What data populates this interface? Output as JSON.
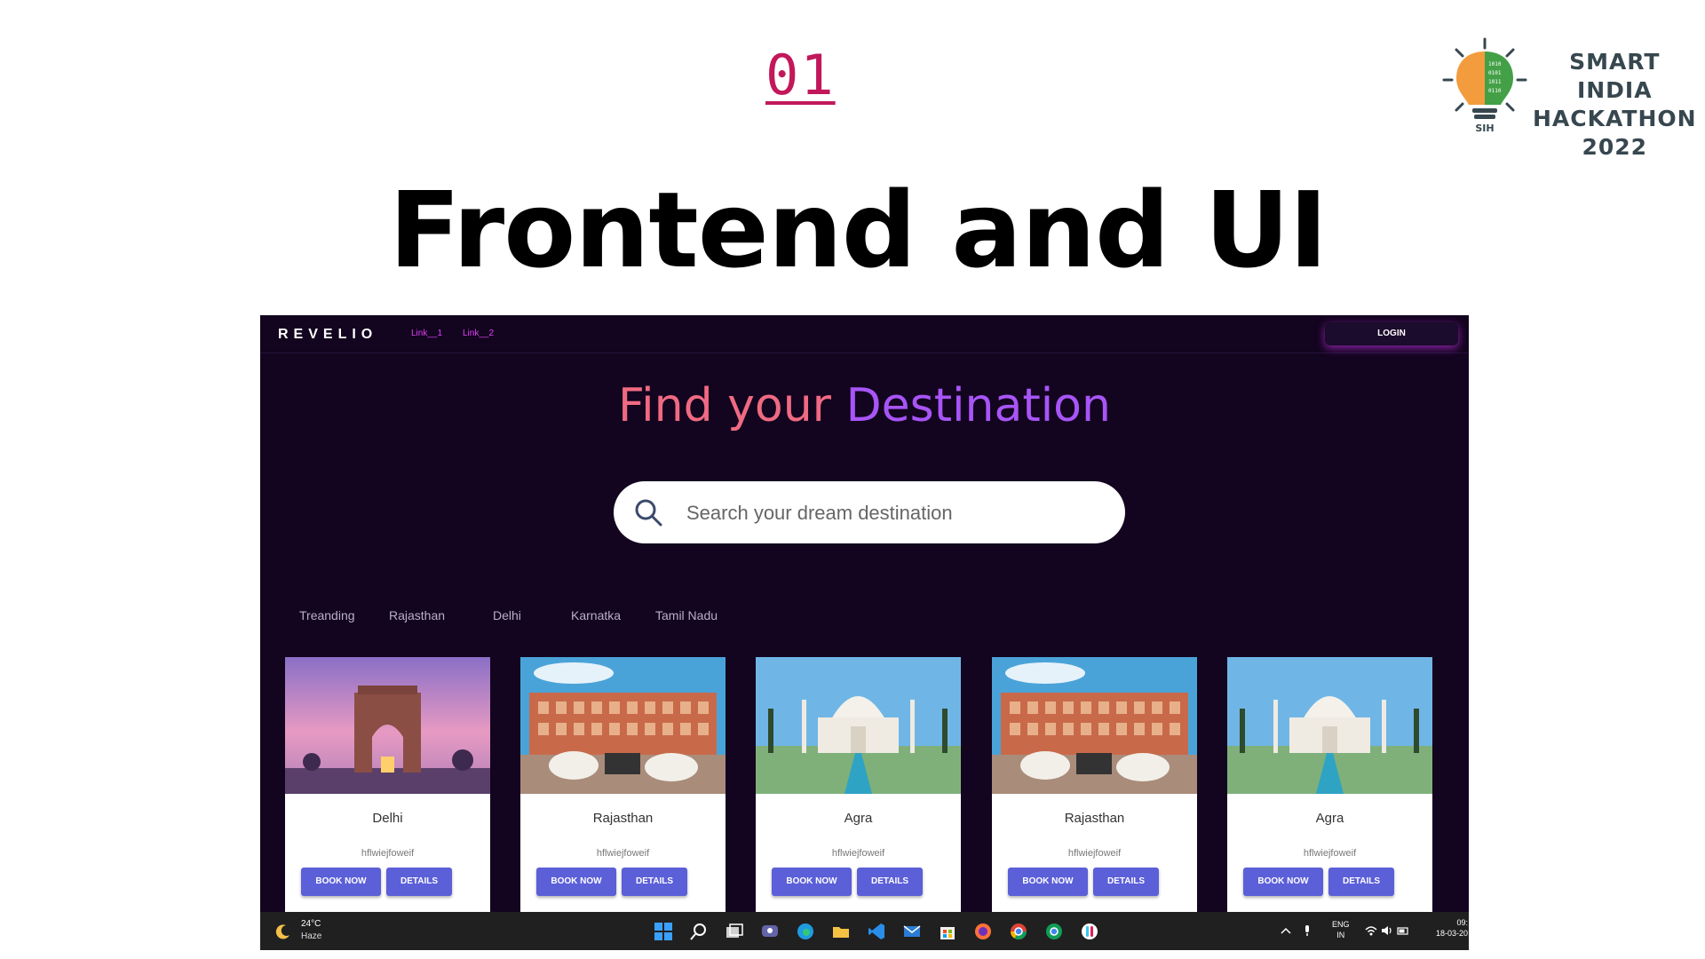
{
  "slide": {
    "number": "01",
    "title": "Frontend and UI",
    "logo_line1": "SMART INDIA",
    "logo_line2": "HACKATHON",
    "logo_line3": "2022",
    "logo_badge": "SIH"
  },
  "app": {
    "brand": "REVELIO",
    "nav_links": [
      "Link__1",
      "Link__2"
    ],
    "login_label": "LOGIN",
    "hero_part1": "Find your ",
    "hero_part2": "Destination",
    "search_placeholder": "Search your dream destination",
    "tabs": [
      "Treanding",
      "Rajasthan",
      "Delhi",
      "Karnatka",
      "Tamil Nadu"
    ],
    "cards": [
      {
        "title": "Delhi",
        "desc": "hflwiejfoweif",
        "book": "BOOK NOW",
        "details": "DETAILS",
        "image": "india-gate"
      },
      {
        "title": "Rajasthan",
        "desc": "hflwiejfoweif",
        "book": "BOOK NOW",
        "details": "DETAILS",
        "image": "hawa-mahal"
      },
      {
        "title": "Agra",
        "desc": "hflwiejfoweif",
        "book": "BOOK NOW",
        "details": "DETAILS",
        "image": "taj-mahal"
      },
      {
        "title": "Rajasthan",
        "desc": "hflwiejfoweif",
        "book": "BOOK NOW",
        "details": "DETAILS",
        "image": "hawa-mahal"
      },
      {
        "title": "Agra",
        "desc": "hflwiejfoweif",
        "book": "BOOK NOW",
        "details": "DETAILS",
        "image": "taj-mahal"
      }
    ]
  },
  "taskbar": {
    "weather_temp": "24°C",
    "weather_cond": "Haze",
    "weather_icon": "moon-icon",
    "lang_line1": "ENG",
    "lang_line2": "IN",
    "time": "09:",
    "date": "18-03-20"
  },
  "colors": {
    "slide_number": "#c2185b",
    "app_bg": "#13041f",
    "hero_pink": "#ef6a82",
    "hero_purple": "#a855f7",
    "nav_link": "#e040fb",
    "button": "#5b5fd8"
  }
}
